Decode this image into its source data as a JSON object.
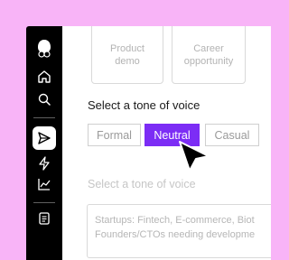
{
  "sidebar": {
    "items": [
      {
        "icon": "logo-icon"
      },
      {
        "icon": "home-icon"
      },
      {
        "icon": "search-icon"
      },
      {
        "icon": "send-icon",
        "active": true
      },
      {
        "icon": "lightning-icon"
      },
      {
        "icon": "chart-icon"
      },
      {
        "icon": "document-icon"
      }
    ]
  },
  "cards": [
    {
      "line1": "Product",
      "line2": "demo"
    },
    {
      "line1": "Career",
      "line2": "opportunity"
    }
  ],
  "tone": {
    "heading": "Select a tone of voice",
    "options": [
      "Formal",
      "Neutral",
      "Casual"
    ],
    "selected": "Neutral"
  },
  "second_section": {
    "heading": "Select a tone of voice"
  },
  "textarea": {
    "line1": "Startups: Fintech, E-commerce, Biot",
    "line2": "Founders/CTOs needing developme"
  },
  "colors": {
    "background": "#f8b4f7",
    "accent": "#7c2df5",
    "sidebar": "#000000"
  }
}
